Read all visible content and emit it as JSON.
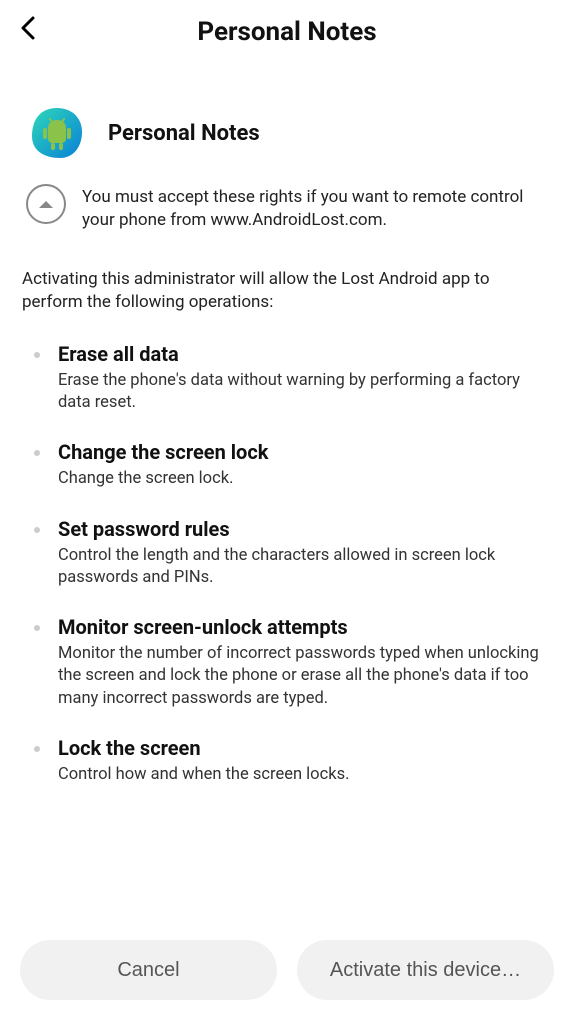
{
  "header": {
    "title": "Personal Notes"
  },
  "app": {
    "name": "Personal Notes"
  },
  "notice": "You must accept these rights if you want to remote control your phone from www.AndroidLost.com.",
  "intro": "Activating this administrator will allow the Lost Android app to perform the following operations:",
  "permissions": [
    {
      "title": "Erase all data",
      "desc": "Erase the phone's data without warning by performing a factory data reset."
    },
    {
      "title": "Change the screen lock",
      "desc": "Change the screen lock."
    },
    {
      "title": "Set password rules",
      "desc": "Control the length and the characters allowed in screen lock passwords and PINs."
    },
    {
      "title": "Monitor screen-unlock attempts",
      "desc": "Monitor the number of incorrect passwords typed when unlocking the screen and lock the phone or erase all the phone's data if too many incorrect passwords are typed."
    },
    {
      "title": "Lock the screen",
      "desc": "Control how and when the screen locks."
    }
  ],
  "buttons": {
    "cancel": "Cancel",
    "activate": "Activate this device…"
  }
}
